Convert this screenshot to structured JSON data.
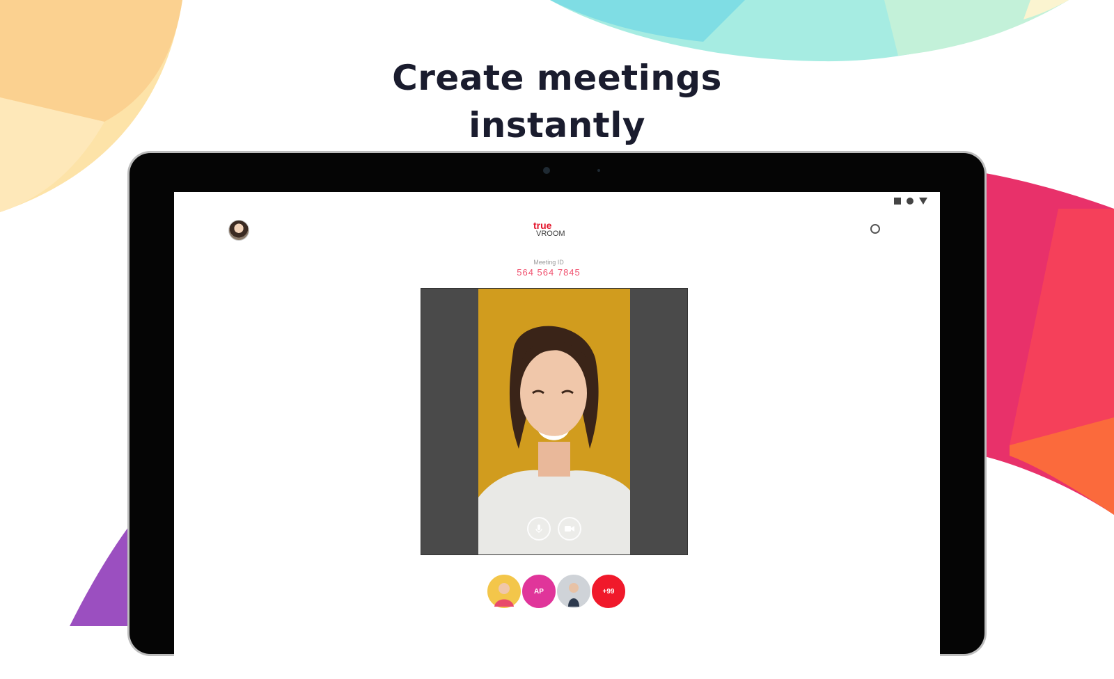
{
  "headline": {
    "line1": "Create meetings",
    "line2": "instantly"
  },
  "app": {
    "logo_primary": "true",
    "logo_secondary": "VROOM",
    "meeting_id_label": "Meeting ID",
    "meeting_id_value": "564 564 7845"
  },
  "participants": [
    {
      "initials": "",
      "color": "#f3c64a",
      "kind": "photo"
    },
    {
      "initials": "AP",
      "color": "#e0359a",
      "kind": "initials"
    },
    {
      "initials": "",
      "color": "#cfd3d8",
      "kind": "photo"
    },
    {
      "initials": "+99",
      "color": "#f0192b",
      "kind": "initials"
    }
  ],
  "colors": {
    "brand_red": "#e3152b",
    "meeting_id": "#f0506e",
    "video_bg": "#d19c1e"
  }
}
